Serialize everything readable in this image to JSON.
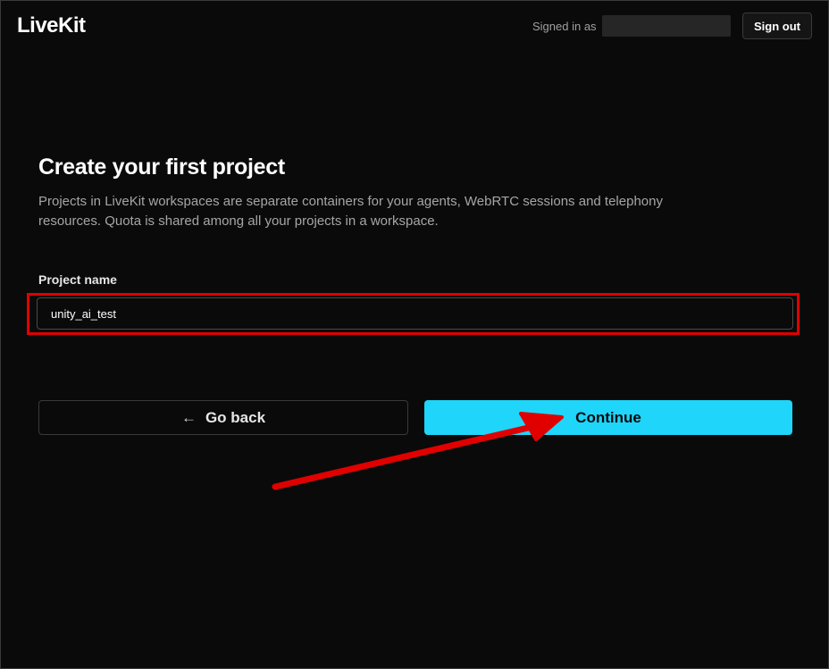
{
  "header": {
    "logo_text": "LiveKit",
    "signed_in_label": "Signed in as",
    "sign_out_label": "Sign out"
  },
  "main": {
    "title": "Create your first project",
    "description": "Projects in LiveKit workspaces are separate containers for your agents, WebRTC sessions and telephony resources. Quota is shared among all your projects in a workspace.",
    "project_name": {
      "label": "Project name",
      "value": "unity_ai_test"
    },
    "buttons": {
      "back_label": "Go back",
      "back_icon": "arrow-left-icon",
      "continue_label": "Continue"
    }
  },
  "colors": {
    "background": "#0a0a0a",
    "accent": "#1fd5f9",
    "annotation": "#e00000"
  }
}
